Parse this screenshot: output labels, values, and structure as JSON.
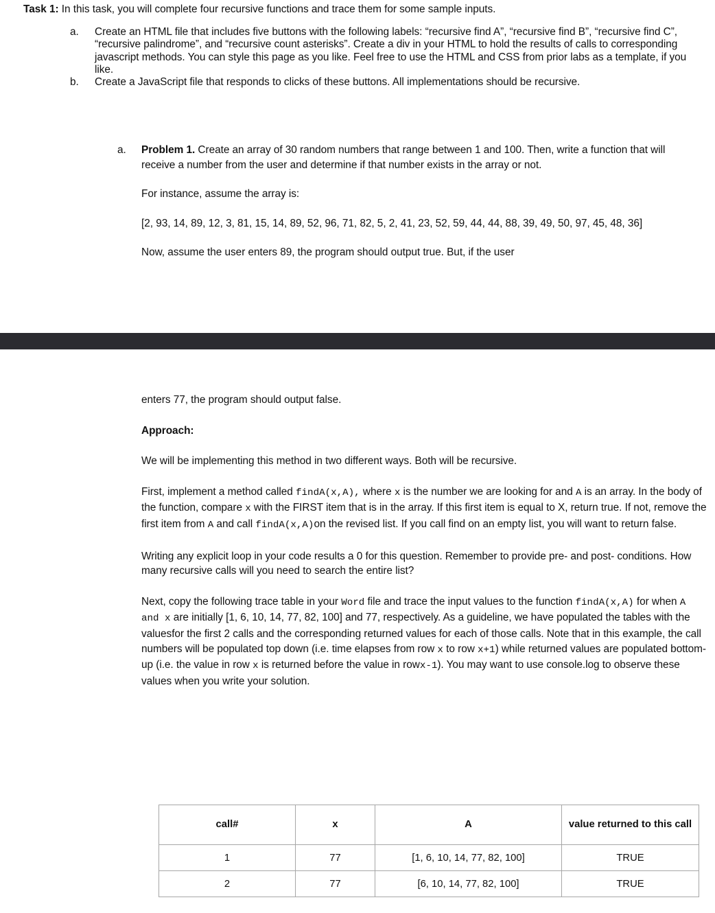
{
  "page_top": {
    "task_heading": {
      "lead": "Task 1:",
      "rest": " In this task, you will complete four recursive functions and trace them for some sample inputs."
    },
    "outer_list": [
      {
        "marker": "a.",
        "text": "Create an HTML file that includes five buttons with the following labels: “recursive find A”, “recursive find B”, “recursive find C”, “recursive palindrome”, and “recursive count asterisks”. Create a div in your HTML to hold the results of calls to corresponding javascript methods.  You can style this page as you like.  Feel free to use the HTML and CSS from prior labs as a template, if you like."
      },
      {
        "marker": "b.",
        "text": "Create a JavaScript file that responds to clicks of these buttons. All implementations should be recursive."
      }
    ],
    "inner_list": {
      "marker": "a.",
      "problem_label": "Problem 1.",
      "problem_rest": " Create an array of 30 random numbers that range between 1 and 100. Then, write a function that will receive a number from the user and determine if that number exists in the array or not.",
      "for_instance": "For instance, assume the array is:",
      "sample_array": "[2, 93, 14, 89, 12, 3, 81, 15, 14, 89, 52, 96, 71, 82, 5, 2, 41, 23, 52, 59, 44, 44, 88, 39, 49, 50, 97, 45, 48, 36]",
      "now_assume": "Now, assume the user enters 89, the program should output true. But, if the user"
    }
  },
  "page_bottom": {
    "continuation": "enters 77, the program should output false.",
    "approach_heading": "Approach:",
    "para_two_ways": "We will be implementing this method in two different ways.  Both will be recursive.",
    "para_first_impl": {
      "s1": "First, implement a method called ",
      "c1": "findA(x,A),",
      "s2": " where ",
      "c2": "x",
      "s3": " is the number we are looking for and ",
      "c3": "A",
      "s4": " is an array.  In the body of the function, compare ",
      "c4": "x",
      "s5": " with the FIRST item that is in the array. If this first item is equal to X, return true.  If not, remove the first item from ",
      "c5": "A",
      "s6": " and call  ",
      "c6": "findA(x,A)",
      "s7": "on the revised list. If you call find on an empty list, you will want to return false."
    },
    "para_loop_warning": "Writing any explicit loop in your code results a 0 for this question. Remember to provide pre- and post- conditions. How many recursive calls will you need to search the entire list?",
    "para_next_copy": {
      "s1": "Next, copy the following trace table in your ",
      "c1": "Word",
      "s2": " file and trace the input values to the function ",
      "c2": "findA(x,A)",
      "s3": " for when ",
      "c3": "A and x",
      "s4": " are initially [1, 6, 10, 14, 77, 82, 100] and 77, respectively. As a guideline, we have populated the tables with the valuesfor the first 2 calls and the corresponding returned values for each of those calls. Note that in this example, the call numbers will be populated top down (i.e. time elapses from row ",
      "c4": "x",
      "s5": "  to row ",
      "c5": "x+1",
      "s6": ") while returned values are populated bottom-up (i.e. the value in row ",
      "c6": "x",
      "s7": "  is returned before the value in row",
      "c7": "x-1",
      "s8": "). You may want to use console.log to observe these values when you write your solution."
    }
  },
  "trace_table": {
    "headers": [
      "call#",
      "x",
      "A",
      "value returned to this call"
    ],
    "rows": [
      [
        "1",
        "77",
        "[1, 6, 10, 14, 77, 82, 100]",
        "TRUE"
      ],
      [
        "2",
        "77",
        "[6, 10, 14, 77, 82, 100]",
        "TRUE"
      ]
    ]
  },
  "colors": {
    "page_background": "#ffffff",
    "text": "#111111",
    "separator_bar": "#2b2b30",
    "table_border": "#a6a6a6"
  }
}
